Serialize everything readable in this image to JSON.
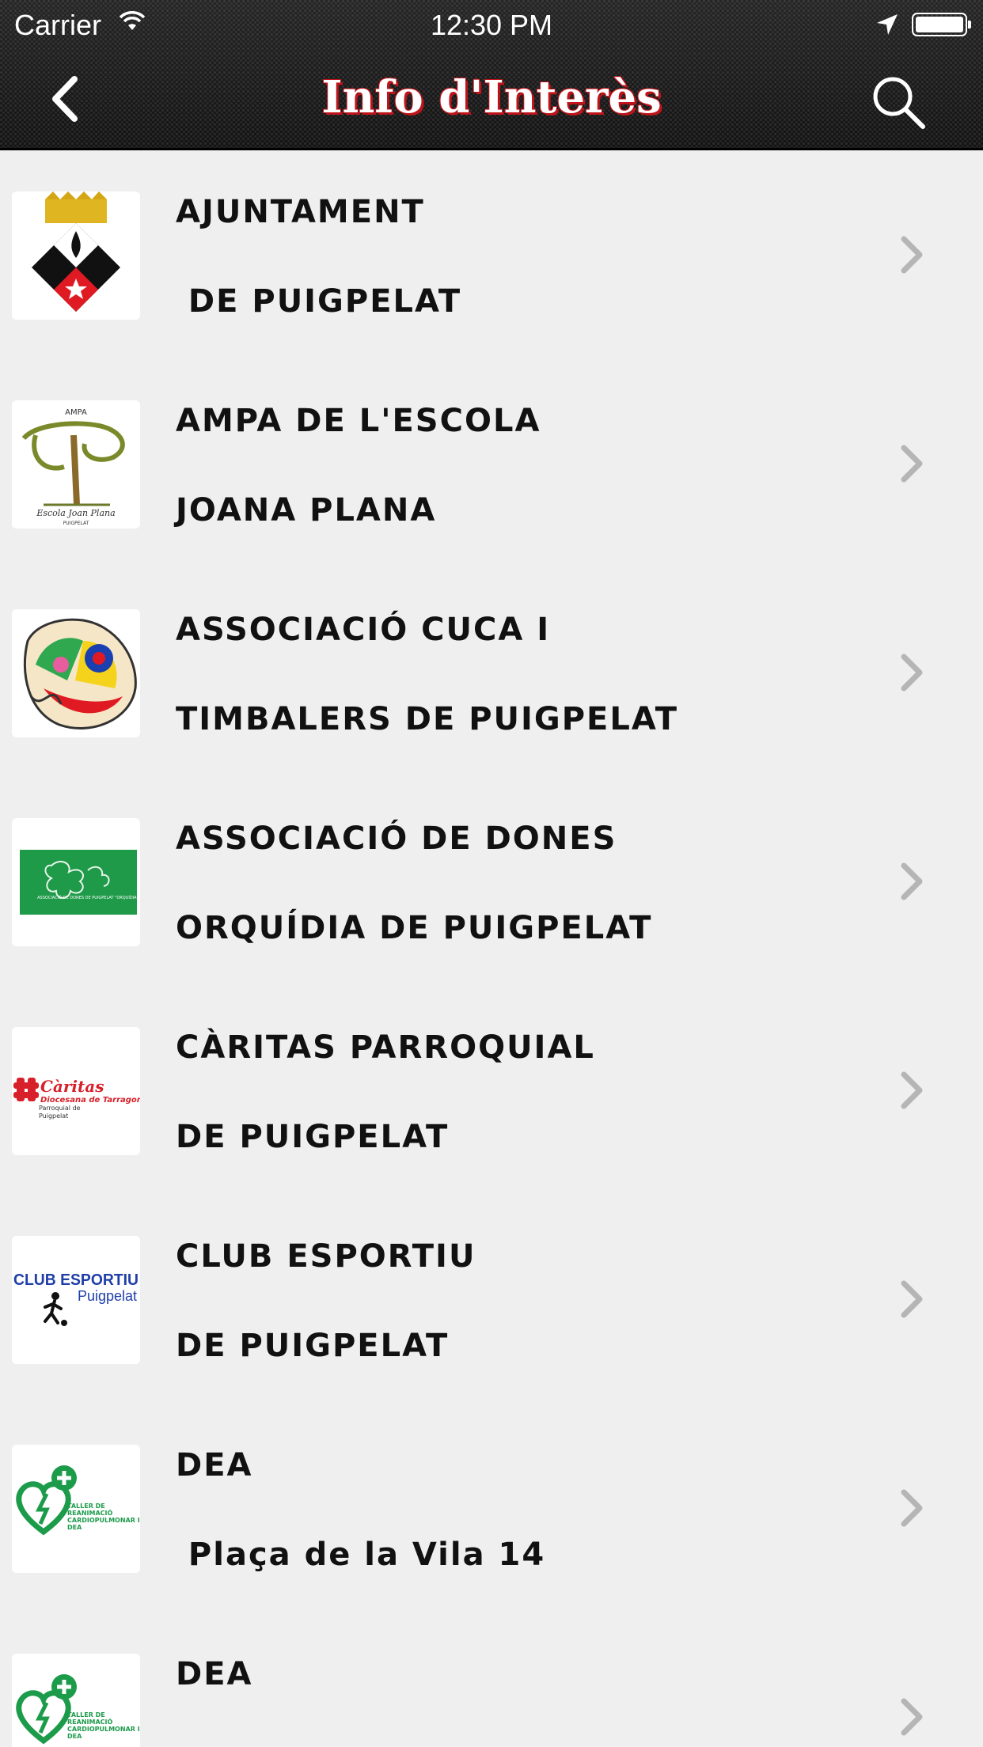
{
  "status_bar": {
    "carrier": "Carrier",
    "time": "12:30 PM"
  },
  "nav": {
    "title": "Info d'Interès",
    "back_icon": "chevron-left-icon",
    "search_icon": "magnifier-icon"
  },
  "colors": {
    "header_bg": "#1c1c1c",
    "title_shadow": "#c0141a",
    "list_bg": "#efefef",
    "chevron": "#b5b5b5"
  },
  "items": [
    {
      "line1": "AJUNTAMENT",
      "line2": " DE PUIGPELAT",
      "logo": "town-coat-of-arms"
    },
    {
      "line1": "AMPA DE L'ESCOLA",
      "line2": "JOANA PLANA",
      "logo": "ampa-tree-logo"
    },
    {
      "line1": "ASSOCIACIÓ CUCA I",
      "line2": "TIMBALERS DE PUIGPELAT",
      "logo": "colorful-face-logo"
    },
    {
      "line1": "ASSOCIACIÓ DE DONES",
      "line2": "ORQUÍDIA DE PUIGPELAT",
      "logo": "orchid-green-banner"
    },
    {
      "line1": "CÀRITAS PARROQUIAL",
      "line2": "DE PUIGPELAT",
      "logo": "caritas-logo"
    },
    {
      "line1": "CLUB ESPORTIU",
      "line2": "DE PUIGPELAT",
      "logo": "club-esportiu-logo"
    },
    {
      "line1": "DEA",
      "line2": " Plaça de la Vila 14",
      "logo": "dea-heart-logo"
    },
    {
      "line1": "DEA",
      "line2": "",
      "logo": "dea-heart-logo"
    }
  ],
  "logo_text": {
    "ampa_top": "AMPA",
    "ampa_bottom": "Escola Joan Plana",
    "ampa_sub": "PUIGPELAT",
    "orchid": "ASSOCIACIÓ DE DONES DE PUIGPELAT \"ORQUÍDIA\"",
    "caritas_name": "Càritas",
    "caritas_line2": "Diocesana de Tarragona",
    "caritas_line3": "Parroquial de",
    "caritas_line4": "Puigpelat",
    "club_line1": "CLUB ESPORTIU",
    "club_line2": "Puigpelat",
    "dea_line1": "TALLER DE",
    "dea_line2": "REANIMACIÓ",
    "dea_line3": "CARDIOPULMONAR I",
    "dea_line4": "DEA"
  }
}
